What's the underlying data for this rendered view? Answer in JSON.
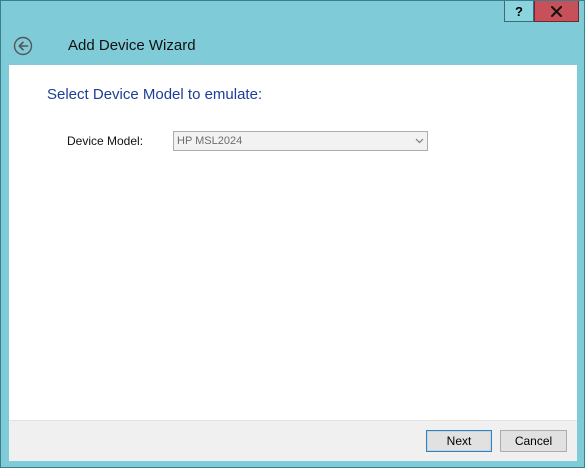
{
  "window": {
    "help_label": "?",
    "close_icon": "close-icon"
  },
  "header": {
    "back_icon": "back-arrow-icon",
    "title": "Add Device Wizard"
  },
  "main": {
    "section_title": "Select Device Model to emulate:",
    "device_model": {
      "label": "Device Model:",
      "selected": "HP MSL2024"
    }
  },
  "footer": {
    "next_label": "Next",
    "cancel_label": "Cancel"
  },
  "colors": {
    "frame": "#7fccd8",
    "section_title": "#1c3f94",
    "close_button": "#c7505a"
  }
}
